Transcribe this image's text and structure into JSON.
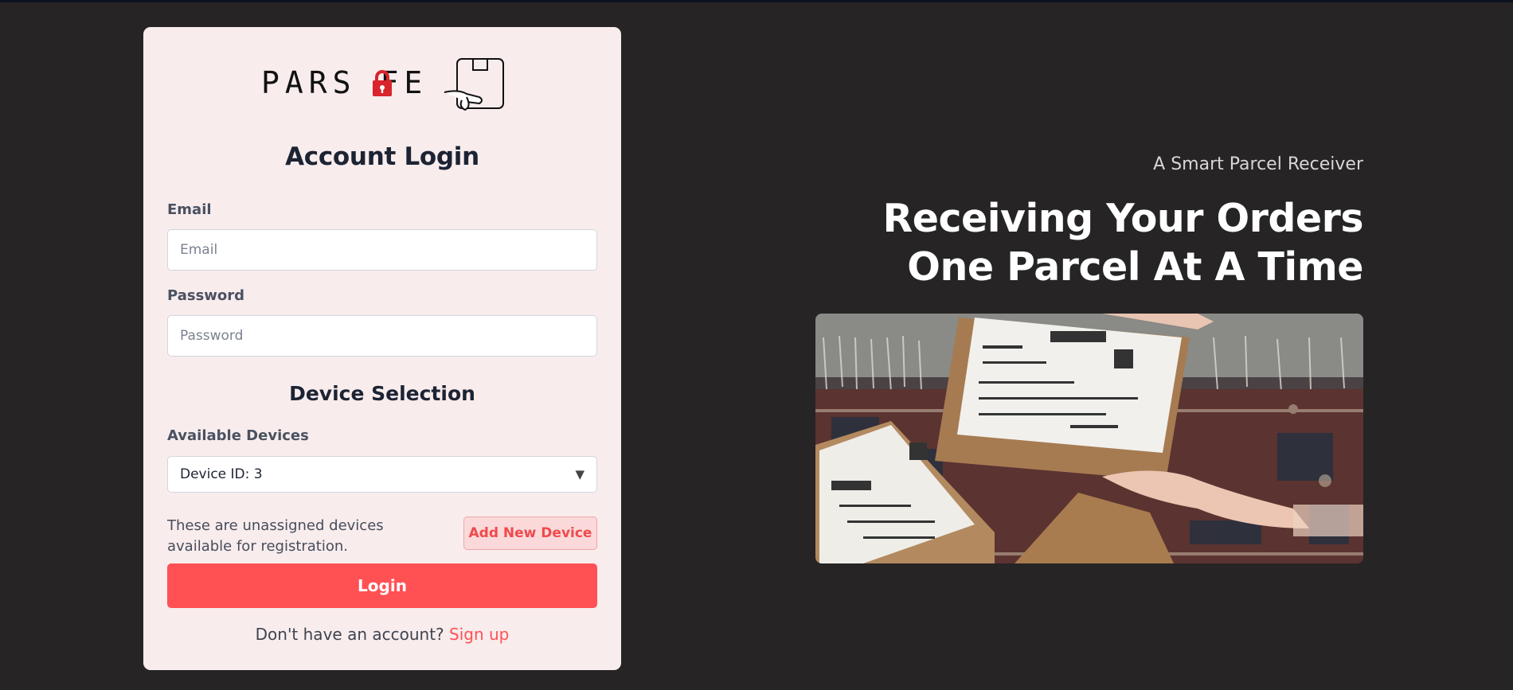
{
  "brand": {
    "logo_text": "PARSAFE",
    "accent": "#ff5154",
    "background": "#262425",
    "card_background": "#f8eced"
  },
  "login": {
    "title": "Account Login",
    "email": {
      "label": "Email",
      "placeholder": "Email",
      "value": ""
    },
    "password": {
      "label": "Password",
      "placeholder": "Password",
      "value": ""
    }
  },
  "device": {
    "section_title": "Device Selection",
    "label": "Available Devices",
    "selected": "Device ID: 3",
    "caret_icon": "caret-down-icon",
    "helper_text": "These are unassigned devices available for registration.",
    "add_button": "Add New Device"
  },
  "actions": {
    "login_button": "Login",
    "signup_prompt": "Don't have an account?",
    "signup_link": "Sign up"
  },
  "hero": {
    "tagline": "A Smart Parcel Receiver",
    "headline": "Receiving Your Orders One Parcel At A Time",
    "image": "parcel-boxes-photo"
  }
}
